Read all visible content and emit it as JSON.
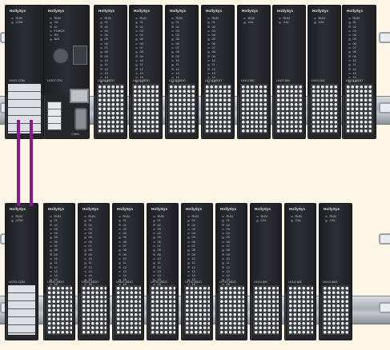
{
  "brand": "HollySys",
  "rack_top": {
    "modules": [
      {
        "name": "LK231 COM",
        "leds": [
          "RUN",
          "COM"
        ]
      },
      {
        "name": "LK207 CPU",
        "leds": [
          "RUN",
          "OK",
          "IO",
          "FORCE",
          "RH",
          "BAT"
        ],
        "port_label": "COM1"
      },
      {
        "name": "LK610 16DO",
        "leds": [
          "RUN",
          "01",
          "02",
          "03",
          "04",
          "05",
          "06",
          "07",
          "08",
          "09",
          "10",
          "11",
          "12",
          "13",
          "14",
          "15",
          "16"
        ]
      },
      {
        "name": "LK610 16DO",
        "leds": [
          "RUN",
          "01",
          "02",
          "03",
          "04",
          "05",
          "06",
          "07",
          "08",
          "09",
          "10",
          "11",
          "12",
          "13",
          "14",
          "15",
          "16"
        ]
      },
      {
        "name": "LK710 16DO",
        "leds": [
          "RUN",
          "01",
          "02",
          "03",
          "04",
          "05",
          "06",
          "07",
          "08",
          "09",
          "10",
          "11",
          "12",
          "13",
          "14",
          "15",
          "16"
        ]
      },
      {
        "name": "LK710 16DO",
        "leds": [
          "RUN",
          "01",
          "02",
          "03",
          "04",
          "05",
          "06",
          "07",
          "08",
          "09",
          "10",
          "11",
          "12",
          "13",
          "14",
          "15",
          "16"
        ]
      },
      {
        "name": "LK411 8AI",
        "leds": [
          "RUN",
          "CAL"
        ]
      },
      {
        "name": "LK411 8AI",
        "leds": [
          "RUN",
          "CAL"
        ]
      },
      {
        "name": "LK411 8AI",
        "leds": [
          "RUN",
          "CAL"
        ]
      },
      {
        "name": "LK610 16DO",
        "leds": [
          "RUN",
          "01",
          "02",
          "03",
          "04",
          "05",
          "06",
          "07",
          "08",
          "09",
          "10",
          "11",
          "12",
          "13",
          "14",
          "15",
          "16"
        ]
      }
    ]
  },
  "rack_bottom": {
    "modules": [
      {
        "name": "LK231 COM",
        "leds": [
          "RUN",
          "COM"
        ]
      },
      {
        "name": "LK610 16DO",
        "leds": [
          "RUN",
          "01",
          "02",
          "03",
          "04",
          "05",
          "06",
          "07",
          "08",
          "09",
          "10",
          "11",
          "12",
          "13",
          "14",
          "15",
          "16"
        ]
      },
      {
        "name": "LK610 16DO",
        "leds": [
          "RUN",
          "01",
          "02",
          "03",
          "04",
          "05",
          "06",
          "07",
          "08",
          "09",
          "10",
          "11",
          "12",
          "13",
          "14",
          "15",
          "16"
        ]
      },
      {
        "name": "LK610 16DO",
        "leds": [
          "RUN",
          "01",
          "02",
          "03",
          "04",
          "05",
          "06",
          "07",
          "08",
          "09",
          "10",
          "11",
          "12",
          "13",
          "14",
          "15",
          "16"
        ]
      },
      {
        "name": "LK710 16DO",
        "leds": [
          "RUN",
          "01",
          "02",
          "03",
          "04",
          "05",
          "06",
          "07",
          "08",
          "09",
          "10",
          "11",
          "12",
          "13",
          "14",
          "15",
          "16"
        ]
      },
      {
        "name": "LK710 16DO",
        "leds": [
          "RUN",
          "01",
          "02",
          "03",
          "04",
          "05",
          "06",
          "07",
          "08",
          "09",
          "10",
          "11",
          "12",
          "13",
          "14",
          "15",
          "16"
        ]
      },
      {
        "name": "LK710 16DO",
        "leds": [
          "RUN",
          "01",
          "02",
          "03",
          "04",
          "05",
          "06",
          "07",
          "08",
          "09",
          "10",
          "11",
          "12",
          "13",
          "14",
          "15",
          "16"
        ]
      },
      {
        "name": "LK411 8AI",
        "leds": [
          "RUN",
          "CAL"
        ]
      },
      {
        "name": "LK411 8AI",
        "leds": [
          "RUN",
          "CAL"
        ]
      },
      {
        "name": "LK411 8AO",
        "leds": [
          "RUN",
          "CAL"
        ]
      }
    ]
  },
  "colors": {
    "background": "#fdf6e7",
    "module": "#25272b",
    "cable": "#8a1a8c",
    "rail": "#b8bcc1"
  }
}
